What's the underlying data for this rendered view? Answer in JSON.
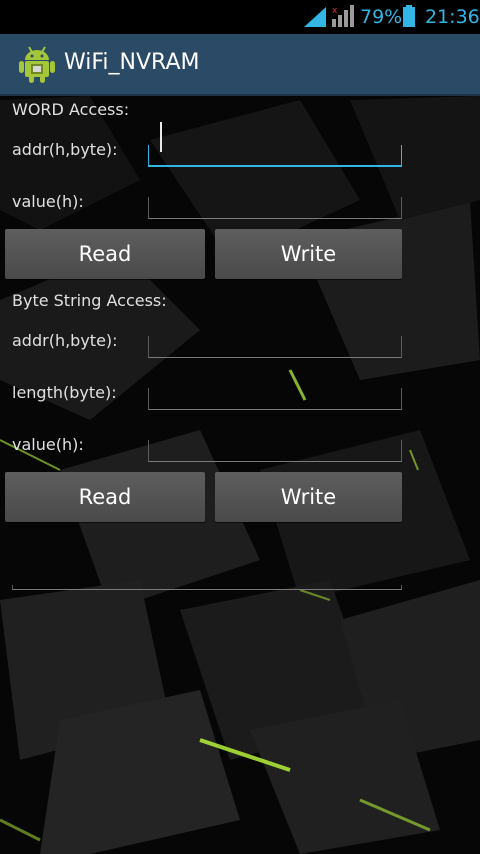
{
  "status_bar": {
    "battery_percent": "79%",
    "time": "21:36",
    "icons": [
      "wifi-icon",
      "signal-icon",
      "battery-icon"
    ],
    "accent_color": "#33b5e5"
  },
  "action_bar": {
    "title": "WiFi_NVRAM",
    "icon": "android-icon",
    "background": "#2a4a66"
  },
  "word_access": {
    "heading": "WORD Access:",
    "addr_label": "addr(h,byte):",
    "addr_value": "",
    "value_label": "value(h):",
    "value_value": "",
    "read_label": "Read",
    "write_label": "Write"
  },
  "byte_string_access": {
    "heading": "Byte String Access:",
    "addr_label": "addr(h,byte):",
    "addr_value": "",
    "length_label": "length(byte):",
    "length_value": "",
    "value_label": "value(h):",
    "value_value": "",
    "read_label": "Read",
    "write_label": "Write"
  },
  "result": {
    "value": ""
  }
}
